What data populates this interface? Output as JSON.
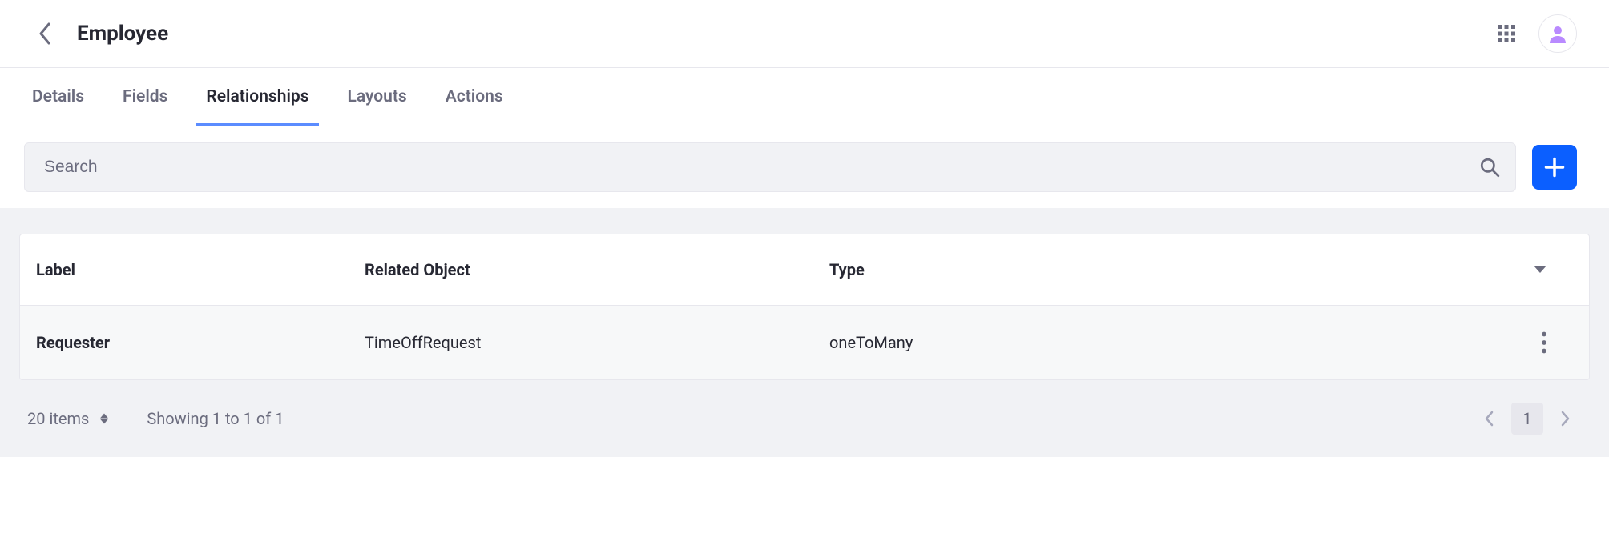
{
  "header": {
    "title": "Employee"
  },
  "tabs": [
    {
      "label": "Details",
      "active": false
    },
    {
      "label": "Fields",
      "active": false
    },
    {
      "label": "Relationships",
      "active": true
    },
    {
      "label": "Layouts",
      "active": false
    },
    {
      "label": "Actions",
      "active": false
    }
  ],
  "search": {
    "placeholder": "Search",
    "value": ""
  },
  "table": {
    "columns": [
      {
        "label": "Label"
      },
      {
        "label": "Related Object"
      },
      {
        "label": "Type"
      }
    ],
    "rows": [
      {
        "label": "Requester",
        "related_object": "TimeOffRequest",
        "type": "oneToMany"
      }
    ]
  },
  "pagination": {
    "page_size_label": "20 items",
    "range_text": "Showing 1 to 1 of 1",
    "current_page": "1"
  }
}
